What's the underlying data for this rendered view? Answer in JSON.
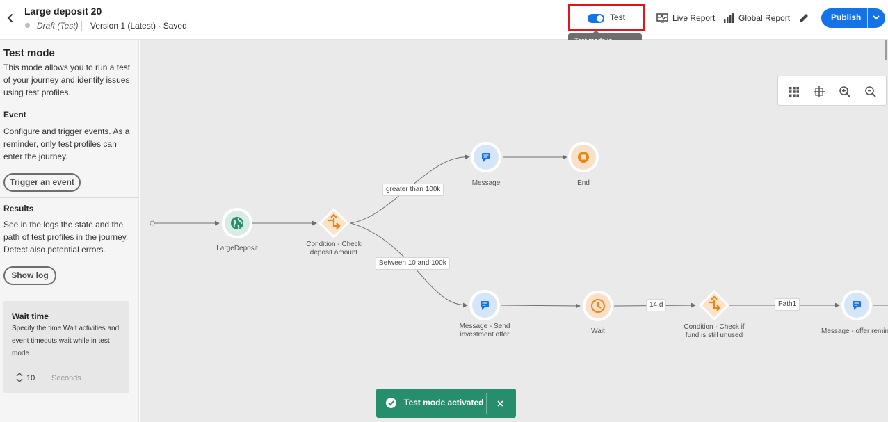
{
  "header": {
    "title": "Large deposit 20",
    "status": "Draft (Test)",
    "version": "Version 1 (Latest) · Saved",
    "test_toggle_label": "Test",
    "tooltip": "Test mode is activated",
    "live_report": "Live Report",
    "global_report": "Global Report",
    "publish": "Publish"
  },
  "sidebar": {
    "title": "Test mode",
    "intro": "This mode allows you to run a test of your journey and identify issues using test profiles.",
    "event_heading": "Event",
    "event_text": "Configure and trigger events. As a reminder, only test profiles can enter the journey.",
    "trigger_button": "Trigger an event",
    "results_heading": "Results",
    "results_text": "See in the logs the state and the path of test profiles in the journey. Detect also potential errors.",
    "show_log_button": "Show log",
    "wait": {
      "title": "Wait time",
      "description": "Specify the time Wait activities and event timeouts wait while in test mode.",
      "value": "10",
      "unit": "Seconds"
    }
  },
  "canvas": {
    "nodes": {
      "large_deposit": "LargeDeposit",
      "condition_check_line1": "Condition - Check",
      "condition_check_line2": "deposit amount",
      "message_top": "Message",
      "end": "End",
      "message_send_line1": "Message - Send",
      "message_send_line2": "investment offer",
      "wait": "Wait",
      "condition_fund_line1": "Condition - Check if",
      "condition_fund_line2": "fund is still unused",
      "message_offer": "Message - offer remin"
    },
    "edges": {
      "greater": "greater than 100k",
      "between": "Between 10 and 100k",
      "days": "14 d",
      "path1": "Path1"
    }
  },
  "toast": {
    "text": "Test mode activated"
  },
  "colors": {
    "accent": "#1473e6",
    "success": "#268e6c",
    "highlight": "#e0141e",
    "condition": "#e68619"
  }
}
